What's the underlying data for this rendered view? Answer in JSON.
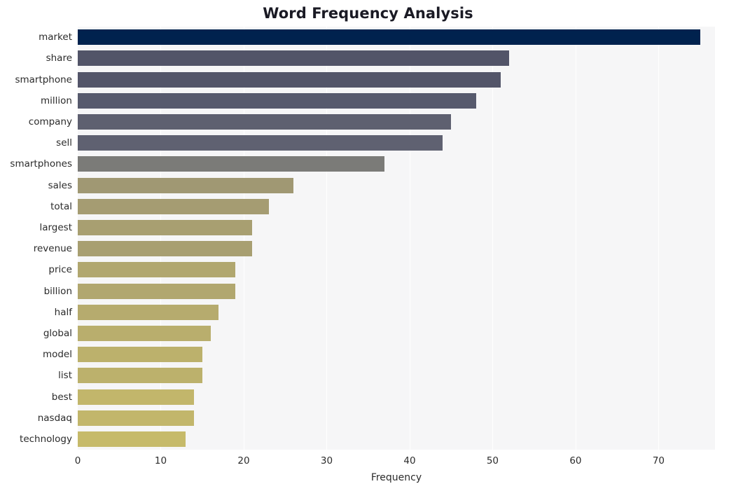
{
  "chart_data": {
    "type": "bar",
    "orientation": "horizontal",
    "title": "Word Frequency Analysis",
    "xlabel": "Frequency",
    "ylabel": "",
    "xlim": [
      0,
      76.8
    ],
    "xticks": [
      0,
      10,
      20,
      30,
      40,
      50,
      60,
      70
    ],
    "xtick_labels": [
      "0",
      "10",
      "20",
      "30",
      "40",
      "50",
      "60",
      "70"
    ],
    "grid": "vertical-only",
    "legend": "none",
    "categories": [
      "market",
      "share",
      "smartphone",
      "million",
      "company",
      "sell",
      "smartphones",
      "sales",
      "total",
      "largest",
      "revenue",
      "price",
      "billion",
      "half",
      "global",
      "model",
      "list",
      "best",
      "nasdaq",
      "technology"
    ],
    "values": [
      75,
      52,
      51,
      48,
      45,
      44,
      37,
      26,
      23,
      21,
      21,
      19,
      19,
      17,
      16,
      15,
      15,
      14,
      14,
      13
    ],
    "bar_colors": [
      "#00224e",
      "#525468",
      "#535569",
      "#575a6d",
      "#5e6070",
      "#5f6171",
      "#7b7b78",
      "#a09873",
      "#a59c72",
      "#a89f71",
      "#a89f71",
      "#b1a76f",
      "#b1a76f",
      "#b6ab6e",
      "#b9ae6d",
      "#bcb16c",
      "#bcb16c",
      "#c2b66b",
      "#c2b66b",
      "#c6ba6a"
    ],
    "colormap": "cividis",
    "plot_background": "#f6f6f7",
    "gridline_color": "#ffffff",
    "figure_background": "#ffffff",
    "text_color": "#2b2b2b",
    "title_color": "#1a1a24"
  }
}
